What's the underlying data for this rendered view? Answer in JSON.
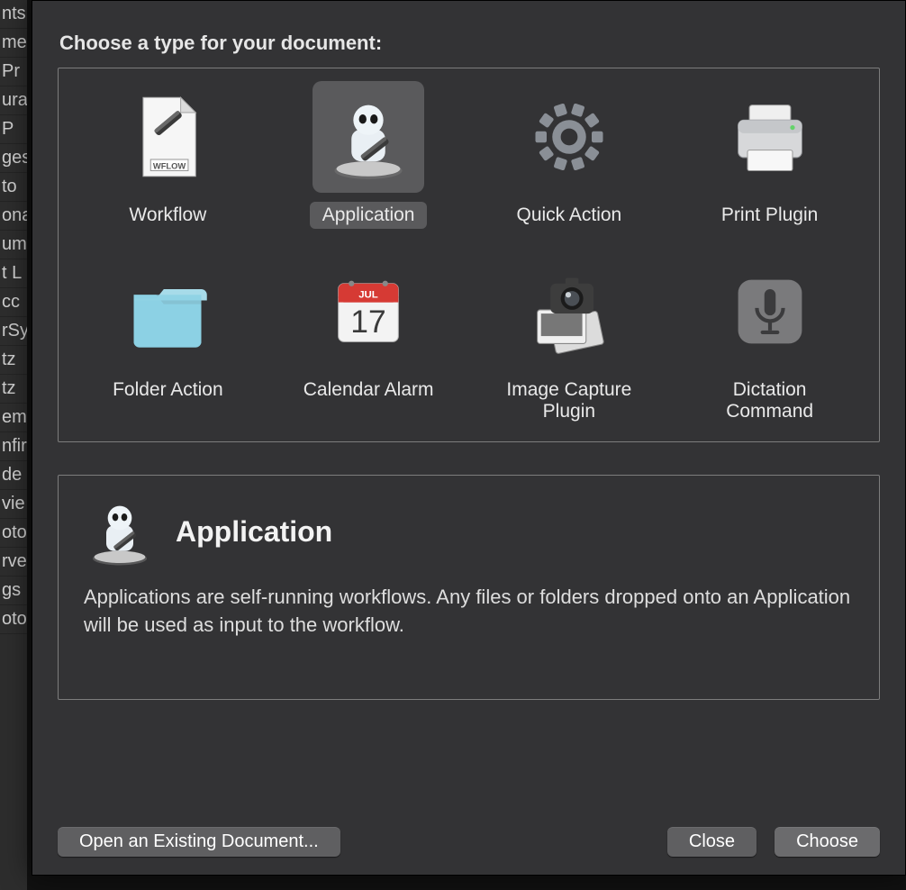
{
  "heading": "Choose a type for your document:",
  "selected_index": 1,
  "types": [
    {
      "label": "Workflow",
      "icon": "workflow-icon"
    },
    {
      "label": "Application",
      "icon": "application-icon"
    },
    {
      "label": "Quick Action",
      "icon": "quick-action-icon"
    },
    {
      "label": "Print Plugin",
      "icon": "print-plugin-icon"
    },
    {
      "label": "Folder Action",
      "icon": "folder-action-icon"
    },
    {
      "label": "Calendar Alarm",
      "icon": "calendar-alarm-icon"
    },
    {
      "label": "Image Capture Plugin",
      "icon": "image-capture-icon"
    },
    {
      "label": "Dictation Command",
      "icon": "dictation-icon"
    }
  ],
  "description": {
    "title": "Application",
    "text": "Applications are self-running workflows. Any files or folders dropped onto an Application will be used as input to the workflow."
  },
  "buttons": {
    "open_existing": "Open an Existing Document...",
    "close": "Close",
    "choose": "Choose"
  },
  "calendar": {
    "month": "JUL",
    "day": "17"
  },
  "workflow_badge": "WFLOW",
  "bg_items": [
    "nts",
    "me",
    "Pr",
    "ura",
    "P",
    "ges",
    "to",
    "ona",
    "um",
    "t L",
    "cc",
    "rSy",
    "tz",
    "tz",
    "em",
    "nfir",
    "de",
    "vie",
    "oto",
    "rve",
    "gs",
    "oto"
  ]
}
